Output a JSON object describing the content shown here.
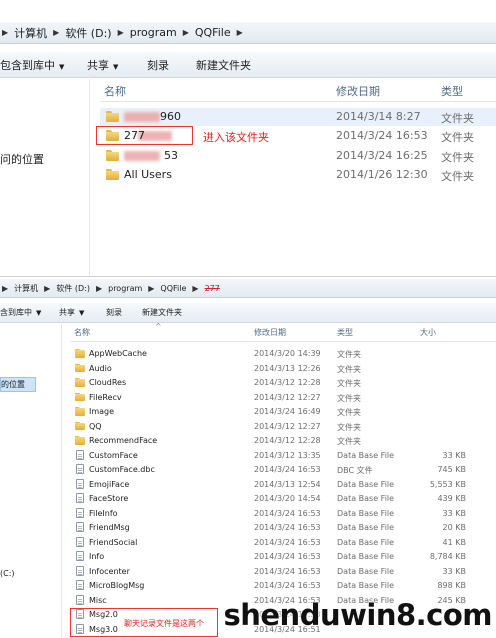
{
  "top": {
    "breadcrumb": [
      "计算机",
      "软件 (D:)",
      "program",
      "QQFile"
    ],
    "toolbar": {
      "include": "包含到库中",
      "share": "共享",
      "burn": "刻录",
      "new_folder": "新建文件夹"
    },
    "nav_item": "问的位置",
    "columns": {
      "name": "名称",
      "date": "修改日期",
      "type": "类型"
    },
    "rows": [
      {
        "name": "960",
        "date": "2014/3/14 8:27",
        "type": "文件夹",
        "blurred": true
      },
      {
        "name": "277",
        "date": "2014/3/24 16:53",
        "type": "文件夹",
        "blurred": true
      },
      {
        "name": "53",
        "date": "2014/3/24 16:25",
        "type": "文件夹",
        "blurred": true
      },
      {
        "name": "All Users",
        "date": "2014/1/26 12:30",
        "type": "文件夹",
        "blurred": false
      }
    ],
    "annotation": "进入该文件夹"
  },
  "bottom": {
    "breadcrumb": [
      "计算机",
      "软件 (D:)",
      "program",
      "QQFile"
    ],
    "crumb_last": "277",
    "toolbar": {
      "include": "含到库中",
      "share": "共享",
      "burn": "刻录",
      "new_folder": "新建文件夹"
    },
    "nav_items": [
      "的位置",
      "(C:)"
    ],
    "columns": {
      "name": "名称",
      "date": "修改日期",
      "type": "类型",
      "size": "大小"
    },
    "rows": [
      {
        "name": "AppWebCache",
        "date": "2014/3/20 14:39",
        "type": "文件夹",
        "size": "",
        "kind": "folder"
      },
      {
        "name": "Audio",
        "date": "2014/3/13 12:26",
        "type": "文件夹",
        "size": "",
        "kind": "folder"
      },
      {
        "name": "CloudRes",
        "date": "2014/3/12 12:28",
        "type": "文件夹",
        "size": "",
        "kind": "folder"
      },
      {
        "name": "FileRecv",
        "date": "2014/3/12 12:27",
        "type": "文件夹",
        "size": "",
        "kind": "folder"
      },
      {
        "name": "Image",
        "date": "2014/3/24 16:49",
        "type": "文件夹",
        "size": "",
        "kind": "folder"
      },
      {
        "name": "QQ",
        "date": "2014/3/12 12:27",
        "type": "文件夹",
        "size": "",
        "kind": "folder"
      },
      {
        "name": "RecommendFace",
        "date": "2014/3/12 12:28",
        "type": "文件夹",
        "size": "",
        "kind": "folder"
      },
      {
        "name": "CustomFace",
        "date": "2014/3/12 13:35",
        "type": "Data Base File",
        "size": "33 KB",
        "kind": "file"
      },
      {
        "name": "CustomFace.dbc",
        "date": "2014/3/24 16:53",
        "type": "DBC 文件",
        "size": "745 KB",
        "kind": "file"
      },
      {
        "name": "EmojiFace",
        "date": "2014/3/13 12:54",
        "type": "Data Base File",
        "size": "5,553 KB",
        "kind": "file"
      },
      {
        "name": "FaceStore",
        "date": "2014/3/20 14:54",
        "type": "Data Base File",
        "size": "439 KB",
        "kind": "file"
      },
      {
        "name": "FileInfo",
        "date": "2014/3/24 16:53",
        "type": "Data Base File",
        "size": "33 KB",
        "kind": "file"
      },
      {
        "name": "FriendMsg",
        "date": "2014/3/24 16:53",
        "type": "Data Base File",
        "size": "20 KB",
        "kind": "file"
      },
      {
        "name": "FriendSocial",
        "date": "2014/3/24 16:53",
        "type": "Data Base File",
        "size": "41 KB",
        "kind": "file"
      },
      {
        "name": "Info",
        "date": "2014/3/24 16:53",
        "type": "Data Base File",
        "size": "8,784 KB",
        "kind": "file"
      },
      {
        "name": "Infocenter",
        "date": "2014/3/24 16:53",
        "type": "Data Base File",
        "size": "33 KB",
        "kind": "file"
      },
      {
        "name": "MicroBlogMsg",
        "date": "2014/3/24 16:53",
        "type": "Data Base File",
        "size": "898 KB",
        "kind": "file"
      },
      {
        "name": "Misc",
        "date": "2014/3/24 16:53",
        "type": "Data Base File",
        "size": "245 KB",
        "kind": "file"
      },
      {
        "name": "Msg2.0",
        "date": "2014/3/24 16:53",
        "type": "",
        "size": "",
        "kind": "file"
      },
      {
        "name": "Msg3.0",
        "date": "2014/3/24 16:51",
        "type": "",
        "size": "",
        "kind": "file"
      }
    ],
    "annotation": "聊天记录文件是这两个"
  },
  "watermark": "shenduwin8.com"
}
